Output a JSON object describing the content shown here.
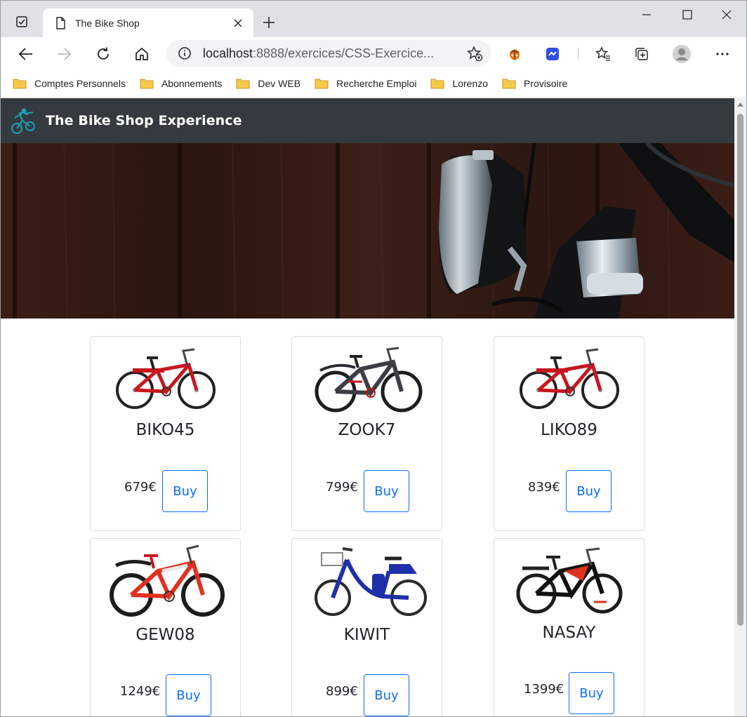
{
  "browser": {
    "tab_title": "The Bike Shop",
    "url_host": "localhost",
    "url_rest": ":8888/exercices/CSS-Exercice...",
    "bookmarks": [
      {
        "label": "Comptes Personnels"
      },
      {
        "label": "Abonnements"
      },
      {
        "label": "Dev WEB"
      },
      {
        "label": "Recherche Emploi"
      },
      {
        "label": "Lorenzo"
      },
      {
        "label": "Provisoire"
      }
    ]
  },
  "site": {
    "brand": "The Bike Shop Experience",
    "accent": "#0d6efd",
    "navbar_color": "#343a40",
    "products": [
      {
        "model": "BIKO45",
        "price": "679€",
        "buy_label": "Buy",
        "bike_color": "#c8161d",
        "style": "red-mtb"
      },
      {
        "model": "ZOOK7",
        "price": "799€",
        "buy_label": "Buy",
        "bike_color": "#3b3e45",
        "style": "grey-mtb"
      },
      {
        "model": "LIKO89",
        "price": "839€",
        "buy_label": "Buy",
        "bike_color": "#c8161d",
        "style": "red-mtb"
      },
      {
        "model": "GEW08",
        "price": "1249€",
        "buy_label": "Buy",
        "bike_color": "#e2301f",
        "style": "red-white-mtb"
      },
      {
        "model": "KIWIT",
        "price": "899€",
        "buy_label": "Buy",
        "bike_color": "#1f2fa8",
        "style": "blue-ebike"
      },
      {
        "model": "NASAY",
        "price": "1399€",
        "buy_label": "Buy",
        "bike_color": "#e0301e",
        "style": "black-red-mtb"
      }
    ]
  }
}
